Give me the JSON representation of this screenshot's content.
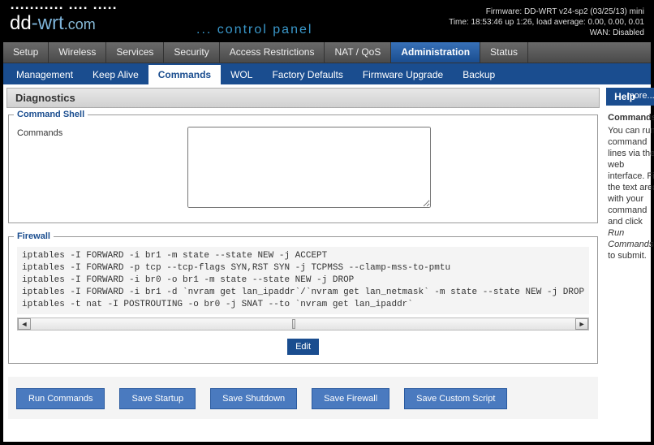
{
  "header": {
    "ticks": "▪▪▪▪▪▪▪▪▪▪▪ ▪▪▪▪ ▪▪▪▪▪",
    "logo_dd": "dd",
    "logo_wrt": "-wrt",
    "logo_com": ".com",
    "cp_prefix": "...",
    "cp_text": "control panel",
    "firmware": "Firmware: DD-WRT v24-sp2 (03/25/13) mini",
    "time": "Time: 18:53:46 up 1:26, load average: 0.00, 0.00, 0.01",
    "wan": "WAN: Disabled"
  },
  "tabs": [
    {
      "label": "Setup",
      "name": "tab-setup"
    },
    {
      "label": "Wireless",
      "name": "tab-wireless"
    },
    {
      "label": "Services",
      "name": "tab-services"
    },
    {
      "label": "Security",
      "name": "tab-security"
    },
    {
      "label": "Access Restrictions",
      "name": "tab-access-restrictions"
    },
    {
      "label": "NAT / QoS",
      "name": "tab-nat-qos"
    },
    {
      "label": "Administration",
      "name": "tab-administration",
      "active": true
    },
    {
      "label": "Status",
      "name": "tab-status"
    }
  ],
  "subtabs": [
    {
      "label": "Management",
      "name": "subtab-management"
    },
    {
      "label": "Keep Alive",
      "name": "subtab-keep-alive"
    },
    {
      "label": "Commands",
      "name": "subtab-commands",
      "active": true
    },
    {
      "label": "WOL",
      "name": "subtab-wol"
    },
    {
      "label": "Factory Defaults",
      "name": "subtab-factory-defaults"
    },
    {
      "label": "Firmware Upgrade",
      "name": "subtab-firmware-upgrade"
    },
    {
      "label": "Backup",
      "name": "subtab-backup"
    }
  ],
  "panels": {
    "diagnostics_title": "Diagnostics",
    "command_shell_label": "Command Shell",
    "commands_field_label": "Commands",
    "commands_value": "",
    "firewall_label": "Firewall",
    "firewall_script": "iptables -I FORWARD -i br1 -m state --state NEW -j ACCEPT\niptables -I FORWARD -p tcp --tcp-flags SYN,RST SYN -j TCPMSS --clamp-mss-to-pmtu\niptables -I FORWARD -i br0 -o br1 -m state --state NEW -j DROP\niptables -I FORWARD -i br1 -d `nvram get lan_ipaddr`/`nvram get lan_netmask` -m state --state NEW -j DROP\niptables -t nat -I POSTROUTING -o br0 -j SNAT --to `nvram get lan_ipaddr`",
    "edit_btn": "Edit"
  },
  "buttons": {
    "run": "Run Commands",
    "save_startup": "Save Startup",
    "save_shutdown": "Save Shutdown",
    "save_firewall": "Save Firewall",
    "save_custom": "Save Custom Script"
  },
  "help": {
    "title": "Help",
    "more": "more...",
    "heading": "Commands:",
    "text_pre": "You can run command lines via the web interface. Fill the text area with your command and click ",
    "text_em": "Run Commands",
    "text_post": " to submit."
  }
}
